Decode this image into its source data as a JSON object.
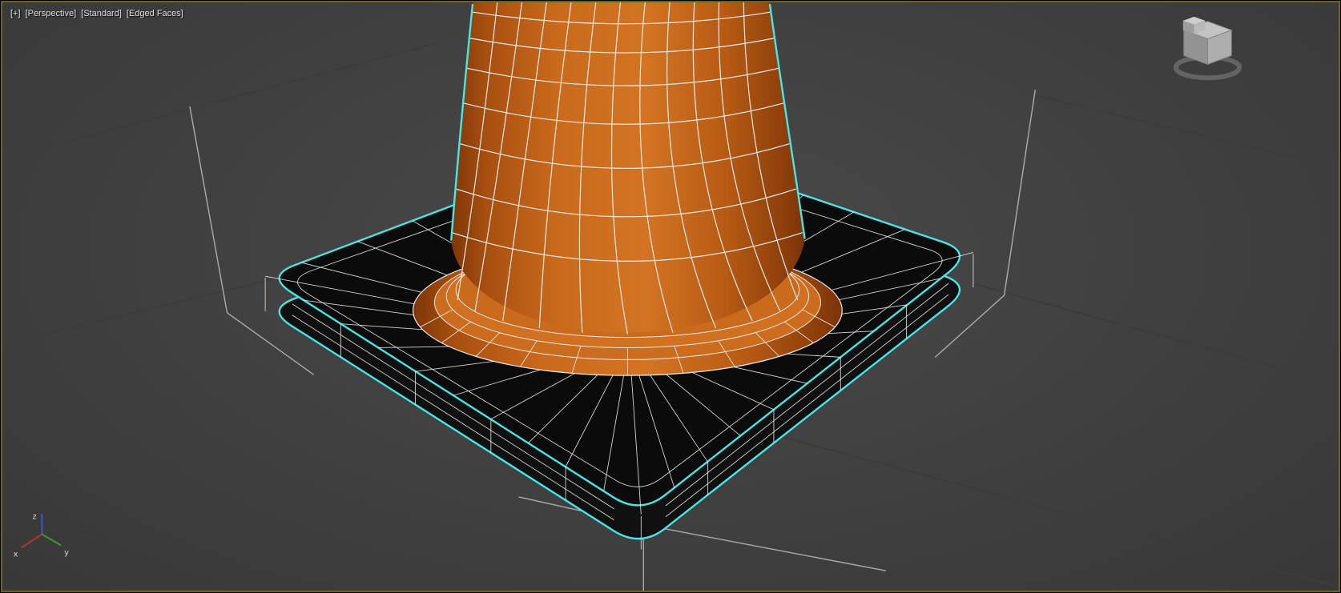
{
  "window": {
    "viewport_label": {
      "menu": "[+]",
      "view": "[Perspective]",
      "renderer": "[Standard]",
      "shading": "[Edged Faces]"
    },
    "axis_gizmo": {
      "x": "x",
      "y": "y",
      "z": "z"
    },
    "colors": {
      "viewport_border": "#6e6419",
      "background_center": "#494949",
      "background_edge": "#383838",
      "grid_line": "#3c3c3c",
      "helper_line": "#c0c0c0",
      "wireframe": "#ebebeb",
      "selection_outline": "#45e8e8",
      "cone_orange": "#c96a1c",
      "cone_orange_light": "#d37423",
      "cone_orange_dark": "#7e3608",
      "base_black": "#0b0b0b",
      "label_text": "#e0e0e0",
      "axis_x": "#b8342a",
      "axis_y": "#3f9a32",
      "axis_z": "#3a56c8"
    }
  }
}
